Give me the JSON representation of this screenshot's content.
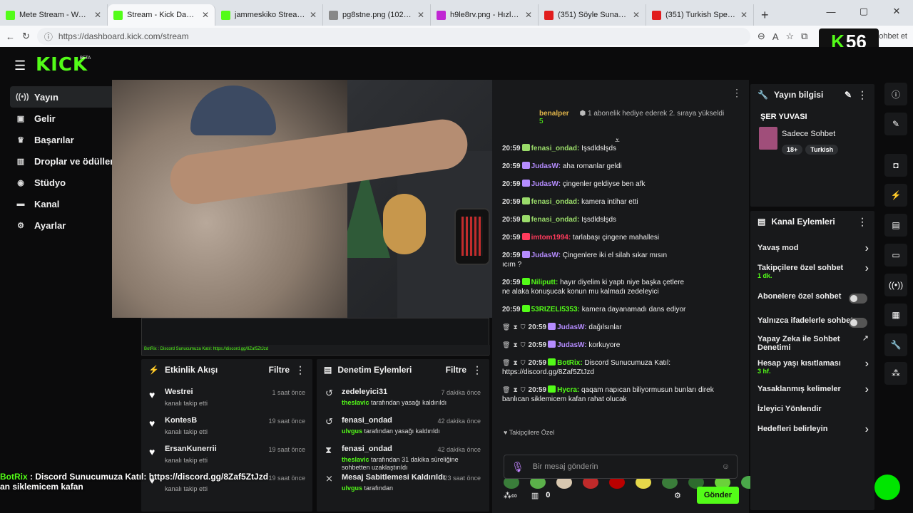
{
  "browser": {
    "tabs": [
      {
        "title": "Mete Stream - Watch Li",
        "color": "#53fc18"
      },
      {
        "title": "Stream - Kick Dashboar",
        "color": "#53fc18",
        "active": true
      },
      {
        "title": "jammeskiko Stream - W",
        "color": "#53fc18"
      },
      {
        "title": "pg8stne.png (1024×572",
        "color": "#888888"
      },
      {
        "title": "h9le8rv.png - Hızlı Resi",
        "color": "#c026d3"
      },
      {
        "title": "(351) Söyle Sunam | 70",
        "color": "#e11d1d"
      },
      {
        "title": "(351) Turkish Special Cu",
        "color": "#e11d1d"
      }
    ],
    "url": "https://dashboard.kick.com/stream",
    "profile_label": "ohbet et"
  },
  "brand": {
    "logo": "KICK",
    "beta": "BETA",
    "accent": "#53fc18",
    "badge_k": "K",
    "badge_num": "56"
  },
  "nav": [
    {
      "label": "Yayın",
      "icon": "broadcast-icon"
    },
    {
      "label": "Gelir",
      "icon": "revenue-icon"
    },
    {
      "label": "Başarılar",
      "icon": "trophy-icon"
    },
    {
      "label": "Droplar ve ödüller",
      "icon": "gift-icon"
    },
    {
      "label": "Stüdyo",
      "icon": "studio-icon"
    },
    {
      "label": "Kanal",
      "icon": "channel-icon"
    },
    {
      "label": "Ayarlar",
      "icon": "gear-icon"
    }
  ],
  "preview": {
    "mini_bar": "BotRix : Discord Sunucumuza Katıl: https://discord.gg/8Zaf5ZtJzd"
  },
  "activity": {
    "title": "Etkinlik Akışı",
    "filter": "Filtre",
    "items": [
      {
        "name": "Westrei",
        "sub": "kanalı takip etti",
        "time": "1 saat önce"
      },
      {
        "name": "KontesB",
        "sub": "kanalı takip etti",
        "time": "19 saat önce"
      },
      {
        "name": "ErsanKunerrii",
        "sub": "kanalı takip etti",
        "time": "19 saat önce"
      },
      {
        "name": "",
        "sub": "kanalı takip etti",
        "time": "19 saat önce"
      }
    ]
  },
  "moderation": {
    "title": "Denetim Eylemleri",
    "filter": "Filtre",
    "items": [
      {
        "name": "zedeleyici31",
        "by": "theslavic",
        "sub": " tarafından yasağı kaldırıldı",
        "time": "7 dakika önce"
      },
      {
        "name": "fenasi_ondad",
        "by": "ulvgus",
        "sub": " tarafından yasağı kaldırıldı",
        "time": "42 dakika önce"
      },
      {
        "name": "fenasi_ondad",
        "by": "theslavic",
        "sub": " tarafından 31 dakika süreliğine sohbetten uzaklaştırıldı",
        "time": "42 dakika önce"
      },
      {
        "name": "Mesaj Sabitlemesi Kaldırıldı",
        "by": "ulvgus",
        "sub": " tarafından",
        "time": "23 saat önce"
      }
    ]
  },
  "chat": {
    "pinned_user": "benalper",
    "pinned_num": "5",
    "pinned_text": "1 abonelik hediye ederek 2. sıraya yükseldi",
    "messages": [
      {
        "time": "20:59",
        "user": "fenasi_ondad:",
        "text": " Işsdldslşds",
        "color": "#9adb6a"
      },
      {
        "time": "20:59",
        "user": "JudasW:",
        "text": " aha romanlar geldi",
        "color": "#b58cff"
      },
      {
        "time": "20:59",
        "user": "JudasW:",
        "text": " çingenler geldiyse ben afk",
        "color": "#b58cff"
      },
      {
        "time": "20:59",
        "user": "fenasi_ondad:",
        "text": " kamera intihar etti",
        "color": "#9adb6a"
      },
      {
        "time": "20:59",
        "user": "fenasi_ondad:",
        "text": " Işsdldslşds",
        "color": "#9adb6a"
      },
      {
        "time": "20:59",
        "user": "imtom1994:",
        "text": " tarlabaşı çingene mahallesi",
        "color": "#ff3b5c"
      },
      {
        "time": "20:59",
        "user": "JudasW:",
        "text": " Çingenlere iki el silah sıkar mısın",
        "extra": "ıcım ?",
        "color": "#b58cff"
      },
      {
        "time": "20:59",
        "user": "Niliputt:",
        "text": " hayır diyelim ki yaptı niye başka çetlere",
        "extra": "ne alaka konuşucak konun mu kalmadı zedeleyici",
        "color": "#53fc18"
      },
      {
        "time": "20:59",
        "user": "53RIZELI5353:",
        "text": " kamera dayanamadı dans ediyor",
        "color": "#53fc18"
      },
      {
        "time": "20:59",
        "user": "JudasW:",
        "text": " dağılsınlar",
        "color": "#b58cff"
      },
      {
        "time": "20:59",
        "user": "JudasW:",
        "text": " korkuyore",
        "color": "#b58cff"
      },
      {
        "time": "20:59",
        "user": "BotRix:",
        "text": " Discord Sunucumuza Katıl:",
        "extra": "https://discord.gg/8Zaf5ZtJzd",
        "color": "#53fc18"
      },
      {
        "time": "20:59",
        "user": "Hycra:",
        "text": " qaqam napıcan biliyormusun bunları direk",
        "extra": "banlıcan siklemicem kafan rahat olucak",
        "color": "#53fc18"
      }
    ],
    "followers_only": "Takipçilere Özel",
    "input_placeholder": "Bir mesaj gönderin",
    "count": "0",
    "send": "Gönder"
  },
  "stream_info": {
    "title": "Yayın bilgisi",
    "stream_title": "ŞER YUVASI",
    "category": "Sadece Sohbet",
    "tags": [
      "18+",
      "Turkish"
    ]
  },
  "channel_actions": {
    "title": "Kanal Eylemleri",
    "items": [
      {
        "label": "Yavaş mod",
        "kind": "chevron"
      },
      {
        "label": "Takipçilere özel sohbet",
        "value": "1 dk.",
        "kind": "chevron"
      },
      {
        "label": "Abonelere özel sohbet",
        "kind": "toggle"
      },
      {
        "label": "Yalnızca ifadelerle sohbet",
        "kind": "toggle"
      },
      {
        "label": "Yapay Zeka ile Sohbet Denetimi",
        "kind": "external"
      },
      {
        "label": "Hesap yaşı kısıtlaması",
        "value": "3 hf.",
        "kind": "chevron"
      },
      {
        "label": "Yasaklanmış kelimeler",
        "kind": "chevron"
      },
      {
        "label": "İzleyici Yönlendir",
        "kind": "none"
      },
      {
        "label": "Hedefleri belirleyin",
        "kind": "chevron"
      }
    ]
  },
  "overlay": {
    "line1_user": "BotRix",
    "line1_text": " : Discord Sunucumuza Katıl: https://discord.gg/8Zaf5ZtJzd",
    "line2": "an siklemicem kafan"
  }
}
